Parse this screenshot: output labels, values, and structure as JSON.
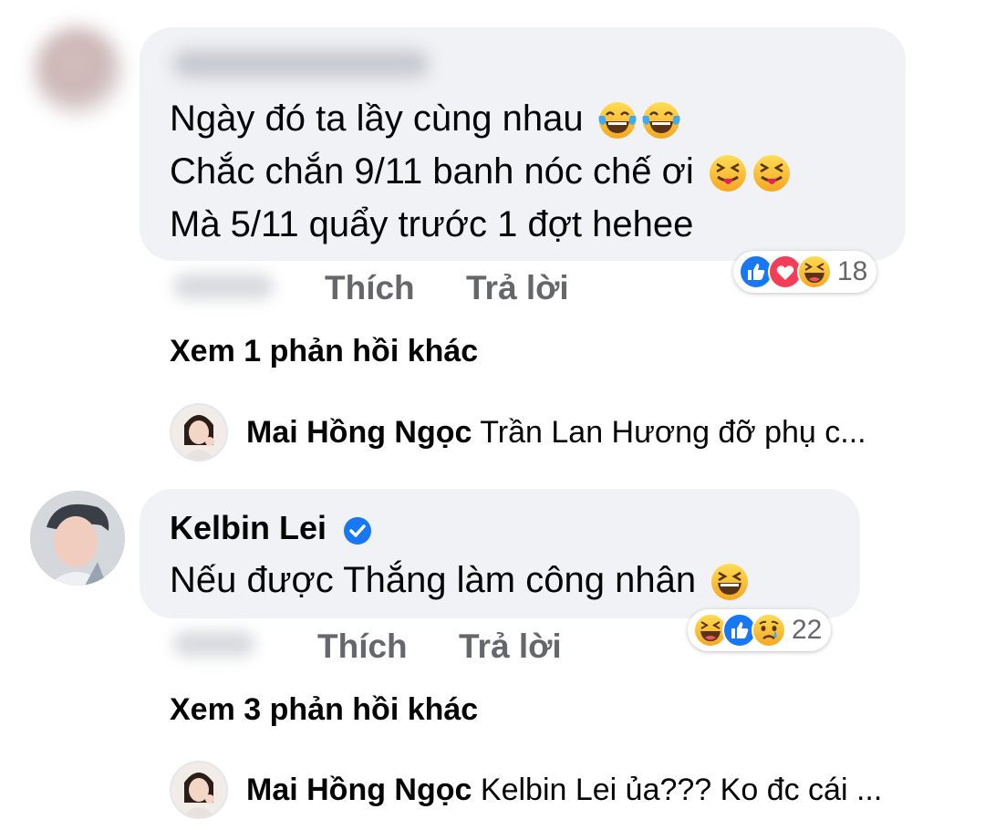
{
  "comment1": {
    "lines": [
      "Ngày đó ta lầy cùng nhau",
      "Chắc chắn 9/11 banh nóc chế ơi",
      "Mà 5/11 quẩy trước 1 đợt hehee"
    ],
    "line_emojis": [
      "tears-of-joy-icon",
      "squinting-tongue-icon",
      ""
    ],
    "reactions": [
      "like-reaction-icon",
      "love-reaction-icon",
      "haha-reaction-icon"
    ],
    "reaction_count": "18",
    "like_label": "Thích",
    "reply_label": "Trả lời",
    "view_more": "Xem 1 phản hồi khác",
    "reply": {
      "name": "Mai Hồng Ngọc",
      "text": "Trần Lan Hương đỡ phụ c..."
    }
  },
  "comment2": {
    "author": "Kelbin Lei",
    "verified": true,
    "text": "Nếu được Thắng làm công nhân",
    "text_emoji": "grinning-squinting-icon",
    "reactions": [
      "haha-reaction-icon",
      "like-reaction-icon",
      "sad-reaction-icon"
    ],
    "reaction_count": "22",
    "like_label": "Thích",
    "reply_label": "Trả lời",
    "view_more": "Xem 3 phản hồi khác",
    "reply": {
      "name": "Mai Hồng Ngọc",
      "text": "Kelbin Lei ủa??? Ko đc cái ..."
    }
  },
  "colors": {
    "bubble": "#f0f2f5",
    "action_gray": "#65676b",
    "like_blue": "#1877f2",
    "love_red": "#f33e58",
    "emoji_yellow": "#fcc437"
  }
}
